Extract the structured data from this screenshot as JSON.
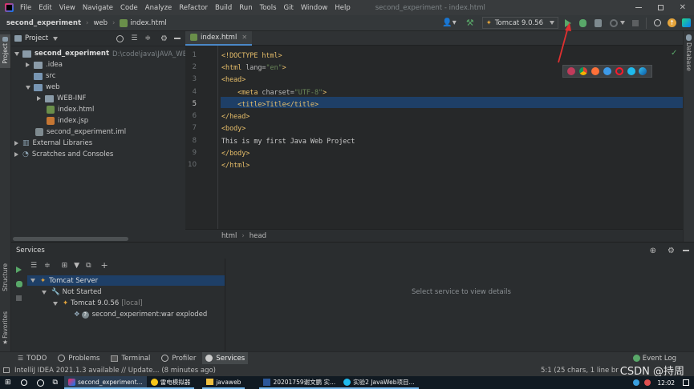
{
  "menu": [
    "File",
    "Edit",
    "View",
    "Navigate",
    "Code",
    "Analyze",
    "Refactor",
    "Build",
    "Run",
    "Tools",
    "Git",
    "Window",
    "Help"
  ],
  "window_title": "second_experiment - index.html",
  "breadcrumb": {
    "project": "second_experiment",
    "folder": "web",
    "file": "index.html"
  },
  "run_config": "Tomcat 9.0.56",
  "project_panel": {
    "title": "Project",
    "root_name": "second_experiment",
    "root_path": "D:\\code\\java\\JAVA_WEB\\大三",
    "items": [
      ".idea",
      "src",
      "web",
      "WEB-INF",
      "index.html",
      "index.jsp",
      "second_experiment.iml",
      "External Libraries",
      "Scratches and Consoles"
    ]
  },
  "editor": {
    "tab": "index.html",
    "line_numbers": [
      "1",
      "2",
      "3",
      "4",
      "5",
      "6",
      "7",
      "8",
      "9",
      "10"
    ],
    "lines": [
      {
        "l1": "<!DOCTYPE html>"
      },
      {
        "l2a": "<html ",
        "l2b": "lang=",
        "l2c": "\"en\"",
        "l2d": ">"
      },
      {
        "l3": "<head>"
      },
      {
        "l4a": "    <meta ",
        "l4b": "charset=",
        "l4c": "\"UTF-8\"",
        "l4d": ">"
      },
      {
        "l5": "    <title>Title</title>"
      },
      {
        "l6": "</head>"
      },
      {
        "l7": "<body>"
      },
      {
        "l8": "This is my first Java Web Project"
      },
      {
        "l9": "</body>"
      },
      {
        "l10": "</html>"
      }
    ],
    "footer_crumbs": [
      "html",
      "head"
    ],
    "current_line": 5
  },
  "right_tool": "Database",
  "left_tools": [
    "Project",
    "Structure",
    "Favorites"
  ],
  "services": {
    "title": "Services",
    "tree": [
      "Tomcat Server",
      "Not Started",
      "Tomcat 9.0.56",
      "[local]",
      "second_experiment:war exploded"
    ],
    "placeholder": "Select service to view details"
  },
  "bottom_tabs": [
    "TODO",
    "Problems",
    "Terminal",
    "Profiler",
    "Services"
  ],
  "event_log": "Event Log",
  "status": {
    "message": "IntelliJ IDEA 2021.1.3 available // Update... (8 minutes ago)",
    "position": "5:1 (25 chars, 1 line br",
    "watermark": "CSDN @持周"
  },
  "taskbar": {
    "apps": [
      "second_experiment...",
      "雷电模拟器",
      "javaweb",
      "20201759谢文鹏 实...",
      "实验2 JavaWeb项目..."
    ],
    "time": "12:02"
  },
  "colors": {
    "accent": "#2d5ba6",
    "run_green": "#59a869",
    "selected": "#1e3f67",
    "arrow_red": "#e03030"
  }
}
